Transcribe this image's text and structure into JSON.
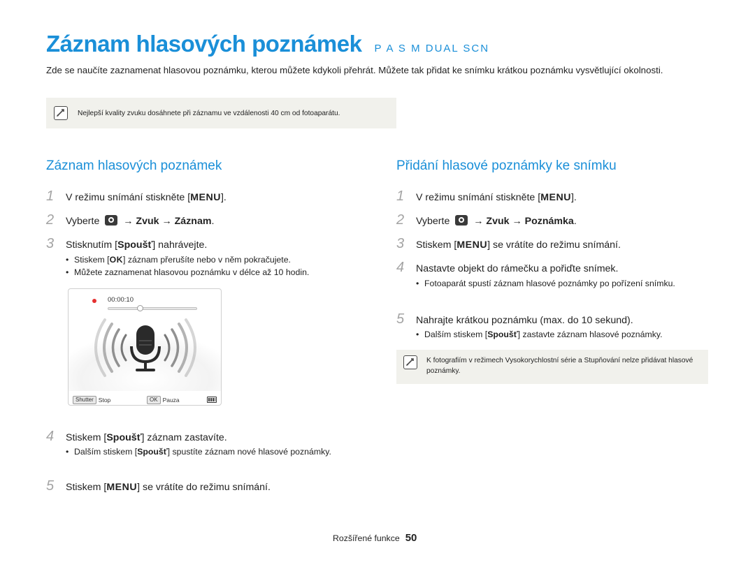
{
  "title": {
    "main": "Záznam hlasových poznámek",
    "modes": "P A S M  DUAL SCN"
  },
  "intro": "Zde se naučíte zaznamenat hlasovou poznámku, kterou můžete kdykoli přehrát. Můžete tak přidat ke snímku krátkou poznámku vysvětlující okolnosti.",
  "note1": "Nejlepší kvality zvuku dosáhnete při záznamu ve vzdálenosti 40 cm od fotoaparátu.",
  "left": {
    "heading": "Záznam hlasových poznámek",
    "step1": {
      "num": "1",
      "pre": "V režimu snímání stiskněte [",
      "key": "MENU",
      "post": "]."
    },
    "step2": {
      "num": "2",
      "pre": "Vyberte",
      "arrow1": "→",
      "item1": "Zvuk",
      "arrow2": "→",
      "item2": "Záznam",
      "post": "."
    },
    "step3": {
      "num": "3",
      "pre": "Stisknutím [",
      "key": "Spoušť",
      "post": "] nahrávejte."
    },
    "bullet3a": {
      "pre": "Stiskem [",
      "key": "OK",
      "post": "] záznam přerušíte nebo v něm pokračujete."
    },
    "bullet3b": "Můžete zaznamenat hlasovou poznámku v délce až 10 hodin.",
    "screen": {
      "time": "00:00:10",
      "shutter_key": "Shutter",
      "shutter_label": "Stop",
      "ok_key": "OK",
      "ok_label": "Pauza"
    },
    "step4": {
      "num": "4",
      "pre": "Stiskem [",
      "key": "Spoušť",
      "post": "] záznam zastavíte."
    },
    "bullet4a": {
      "pre": "Dalším stiskem [",
      "key": "Spoušť",
      "post": "] spustíte záznam nové hlasové poznámky."
    },
    "step5": {
      "num": "5",
      "pre": "Stiskem [",
      "key": "MENU",
      "post": "] se vrátíte do režimu snímání."
    }
  },
  "right": {
    "heading": "Přidání hlasové poznámky ke snímku",
    "step1": {
      "num": "1",
      "pre": "V režimu snímání stiskněte [",
      "key": "MENU",
      "post": "]."
    },
    "step2": {
      "num": "2",
      "pre": "Vyberte",
      "arrow1": "→",
      "item1": "Zvuk",
      "arrow2": "→",
      "item2": "Poznámka",
      "post": "."
    },
    "step3": {
      "num": "3",
      "pre": "Stiskem [",
      "key": "MENU",
      "post": "] se vrátíte do režimu snímání."
    },
    "step4": {
      "num": "4",
      "text": "Nastavte objekt do rámečku a pořiďte snímek."
    },
    "bullet4a": "Fotoaparát spustí záznam hlasové poznámky po pořízení snímku.",
    "step5": {
      "num": "5",
      "text": "Nahrajte krátkou poznámku (max. do 10 sekund)."
    },
    "bullet5a": {
      "pre": "Dalším stiskem [",
      "key": "Spoušť",
      "post": "] zastavte záznam hlasové poznámky."
    },
    "note2": "K fotografiím v režimech Vysokorychlostní série a Stupňování nelze přidávat hlasové poznámky."
  },
  "footer": {
    "label": "Rozšířené funkce",
    "page": "50"
  },
  "colors": {
    "accent": "#1a8fd8",
    "note_bg": "#f1f1ec",
    "step_num": "#a4a4a4"
  }
}
